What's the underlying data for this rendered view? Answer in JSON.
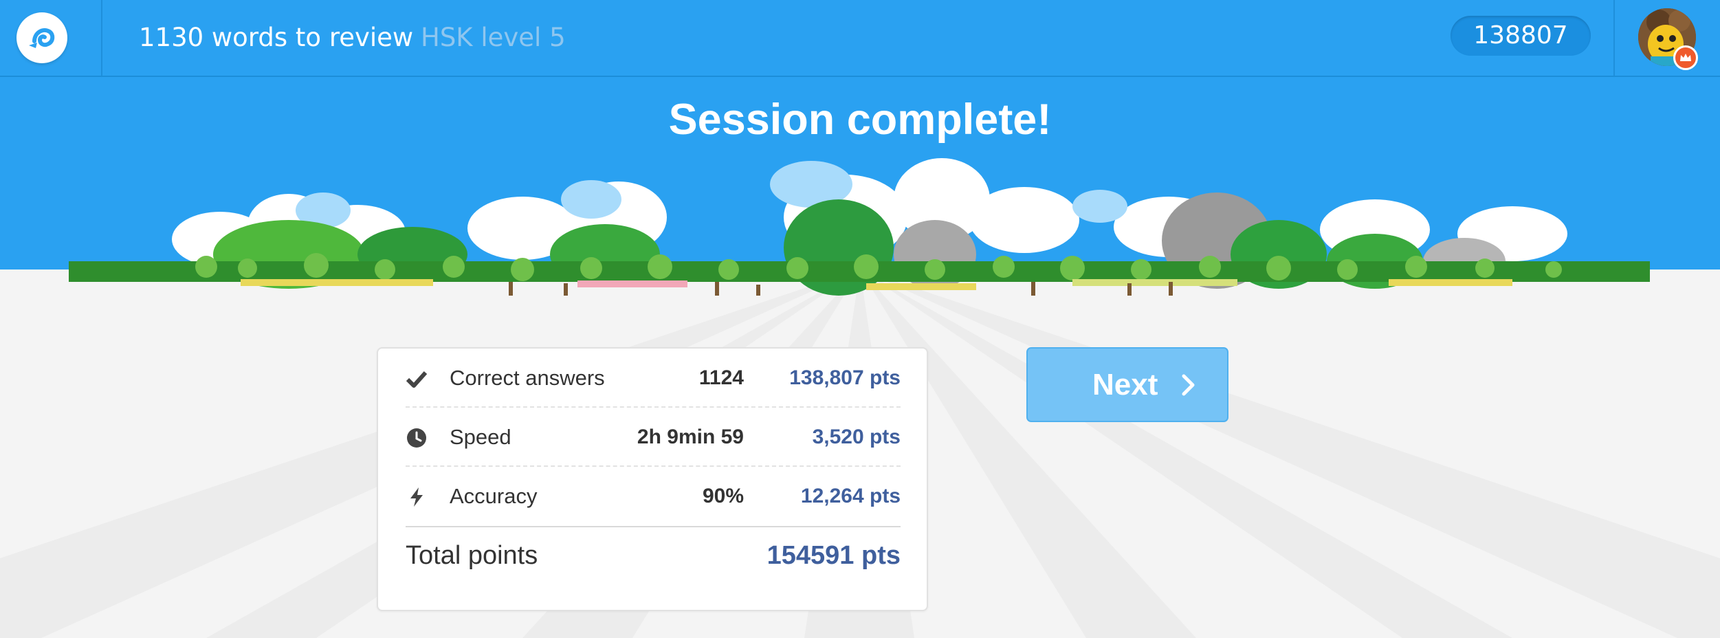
{
  "header": {
    "review_text": "1130 words to review",
    "level_text": "HSK level 5",
    "score": "138807"
  },
  "hero": {
    "title": "Session complete!"
  },
  "results": {
    "rows": [
      {
        "icon": "checkmark-icon",
        "label": "Correct answers",
        "value": "1124",
        "points": "138,807 pts"
      },
      {
        "icon": "clock-icon",
        "label": "Speed",
        "value": "2h 9min 59",
        "points": "3,520 pts"
      },
      {
        "icon": "lightning-icon",
        "label": "Accuracy",
        "value": "90%",
        "points": "12,264 pts"
      }
    ],
    "total_label": "Total points",
    "total_points": "154591 pts"
  },
  "actions": {
    "next_label": "Next"
  },
  "colors": {
    "header_blue": "#2aa1f1",
    "points_blue": "#3f5f9d",
    "next_button": "#75c3f6"
  }
}
